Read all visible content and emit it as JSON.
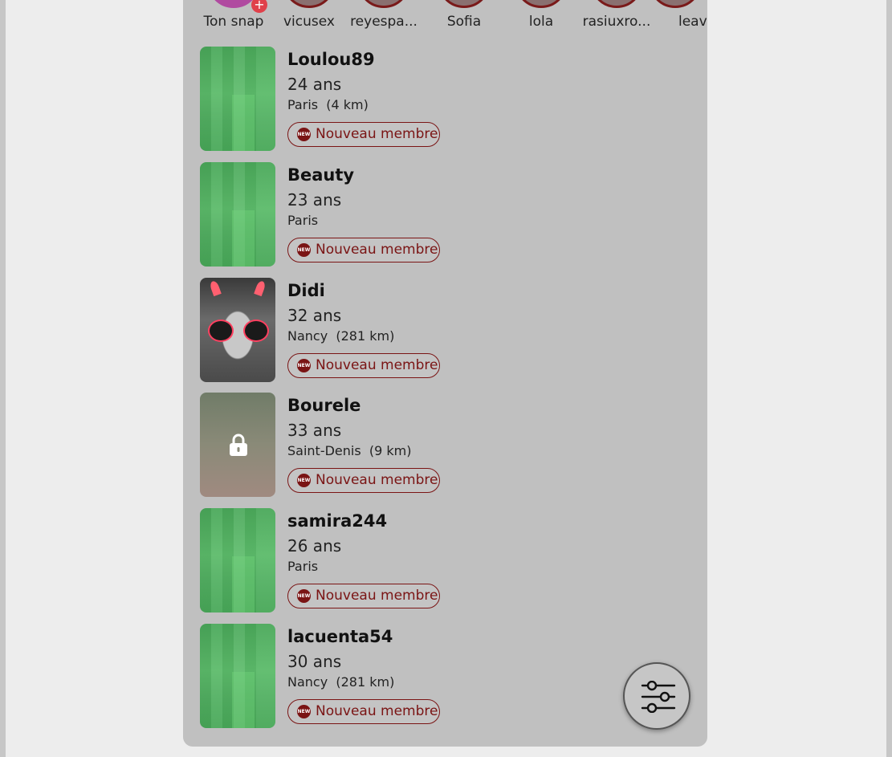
{
  "stories": [
    {
      "name": "Ton snap",
      "own": true
    },
    {
      "name": "vicusex"
    },
    {
      "name": "reyespa..."
    },
    {
      "name": "Sofia"
    },
    {
      "name": "lola"
    },
    {
      "name": "rasiuxro..."
    },
    {
      "name": "leavi"
    }
  ],
  "profiles": [
    {
      "username": "Loulou89",
      "age": "24 ans",
      "city": "Paris",
      "distance": "(4 km)",
      "badge": "Nouveau membre",
      "badge_icon": "NEW",
      "thumb": "green"
    },
    {
      "username": "Beauty",
      "age": "23 ans",
      "city": "Paris",
      "distance": "",
      "badge": "Nouveau membre",
      "badge_icon": "NEW",
      "thumb": "green"
    },
    {
      "username": "Didi",
      "age": "32 ans",
      "city": "Nancy",
      "distance": "(281 km)",
      "badge": "Nouveau membre",
      "badge_icon": "NEW",
      "thumb": "photo"
    },
    {
      "username": "Bourele",
      "age": "33 ans",
      "city": "Saint-Denis",
      "distance": "(9 km)",
      "badge": "Nouveau membre",
      "badge_icon": "NEW",
      "thumb": "lock"
    },
    {
      "username": "samira244",
      "age": "26 ans",
      "city": "Paris",
      "distance": "",
      "badge": "Nouveau membre",
      "badge_icon": "NEW",
      "thumb": "green"
    },
    {
      "username": "lacuenta54",
      "age": "30 ans",
      "city": "Nancy",
      "distance": "(281 km)",
      "badge": "Nouveau membre",
      "badge_icon": "NEW",
      "thumb": "green"
    }
  ],
  "story_plus": "+",
  "colors": {
    "accent": "#7a1414",
    "panel": "#c0c0c0",
    "page": "#ededed"
  },
  "filter_button": {
    "icon": "sliders-icon"
  }
}
